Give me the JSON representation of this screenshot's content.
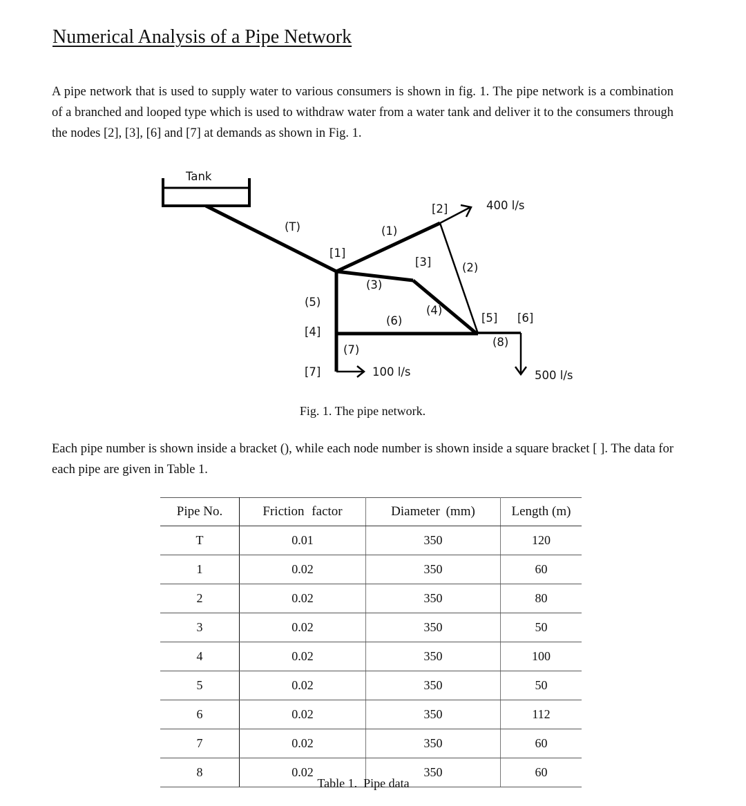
{
  "document": {
    "title": "Numerical Analysis of a Pipe Network",
    "paragraph1": "A pipe network that is used to supply water to various consumers is shown in fig. 1. The pipe network is a combination of a branched and looped type which is used to withdraw water from a water tank and deliver it to the consumers through the nodes [2], [3], [6] and [7] at demands as shown in Fig. 1.",
    "paragraph2": "Each pipe number is shown inside a bracket (), while each node number is shown inside a square bracket [ ]. The data for each pipe are given in Table 1."
  },
  "figure": {
    "caption": "Fig. 1. The pipe network.",
    "tank_label": "Tank",
    "pipe_labels": {
      "T": "(T)",
      "p1": "(1)",
      "p2": "(2)",
      "p3": "(3)",
      "p4": "(4)",
      "p5": "(5)",
      "p6": "(6)",
      "p7": "(7)",
      "p8": "(8)"
    },
    "node_labels": {
      "n1": "[1]",
      "n2": "[2]",
      "n3": "[3]",
      "n4": "[4]",
      "n5": "[5]",
      "n6": "[6]",
      "n7": "[7]"
    },
    "demands": {
      "node2": "400 l/s",
      "node7": "100 l/s",
      "node6": "500 l/s"
    }
  },
  "table": {
    "caption": "Table 1.  Pipe data",
    "headers": [
      "Pipe No.",
      "Friction  factor",
      "Diameter  (mm)",
      "Length (m)"
    ],
    "rows": [
      [
        "T",
        "0.01",
        "350",
        "120"
      ],
      [
        "1",
        "0.02",
        "350",
        "60"
      ],
      [
        "2",
        "0.02",
        "350",
        "80"
      ],
      [
        "3",
        "0.02",
        "350",
        "50"
      ],
      [
        "4",
        "0.02",
        "350",
        "100"
      ],
      [
        "5",
        "0.02",
        "350",
        "50"
      ],
      [
        "6",
        "0.02",
        "350",
        "112"
      ],
      [
        "7",
        "0.02",
        "350",
        "60"
      ],
      [
        "8",
        "0.02",
        "350",
        "60"
      ]
    ]
  }
}
